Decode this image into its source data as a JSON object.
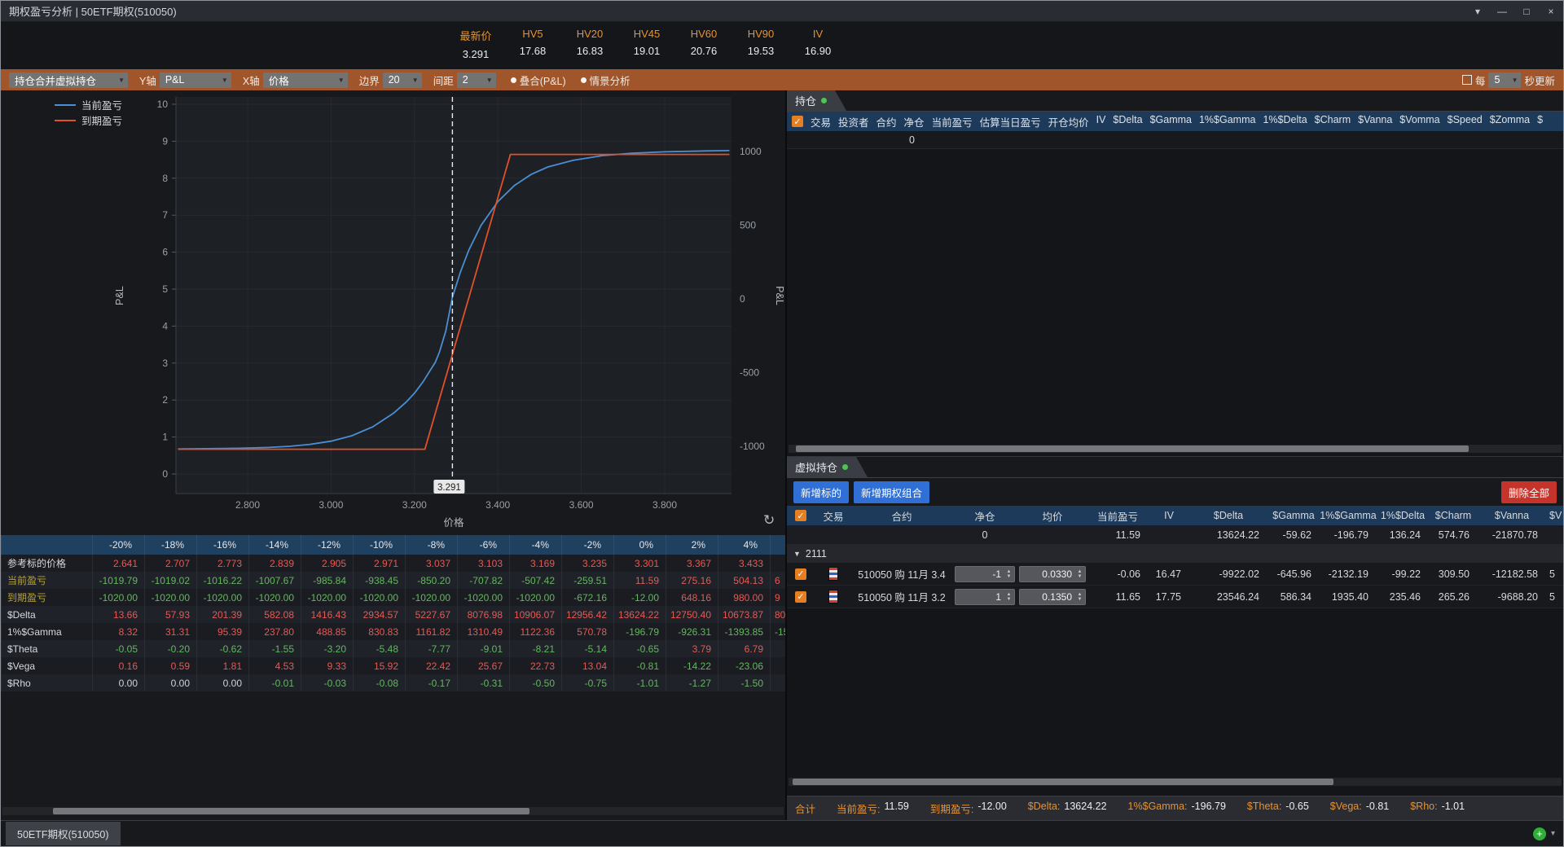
{
  "window": {
    "title": "期权盈亏分析 | 50ETF期权(510050)",
    "controls": {
      "chevron": "▾",
      "minimize": "—",
      "maximize": "□",
      "close": "×"
    }
  },
  "stats": [
    {
      "label": "最新价",
      "value": "3.291"
    },
    {
      "label": "HV5",
      "value": "17.68"
    },
    {
      "label": "HV20",
      "value": "16.83"
    },
    {
      "label": "HV45",
      "value": "19.01"
    },
    {
      "label": "HV60",
      "value": "20.76"
    },
    {
      "label": "HV90",
      "value": "19.53"
    },
    {
      "label": "IV",
      "value": "16.90"
    }
  ],
  "toolbar": {
    "position_mode": "持仓合并虚拟持仓",
    "y_axis_label": "Y轴",
    "y_axis_value": "P&L",
    "x_axis_label": "X轴",
    "x_axis_value": "价格",
    "boundary_label": "边界",
    "boundary_value": "20",
    "interval_label": "间距",
    "interval_value": "2",
    "overlay_label": "叠合(P&L)",
    "scenario_label": "情景分析",
    "refresh_prefix": "每",
    "refresh_value": "5",
    "refresh_suffix": "秒更新"
  },
  "chart": {
    "legend": [
      {
        "name": "当前盈亏",
        "color": "#4a8fd4"
      },
      {
        "name": "到期盈亏",
        "color": "#e0512a"
      }
    ],
    "y_left_ticks": [
      "10",
      "9",
      "8",
      "7",
      "6",
      "5",
      "4",
      "3",
      "2",
      "1",
      "0"
    ],
    "y_right_ticks": [
      "1000",
      "500",
      "0",
      "-500",
      "-1000"
    ],
    "x_ticks": [
      "2.800",
      "3.000",
      "3.200",
      "3.400",
      "3.600",
      "3.800"
    ],
    "x_label": "价格",
    "y_label_left": "P&L",
    "y_label_right": "P&L",
    "marker_value": "3.291",
    "marker_x": 3.291,
    "series": [
      {
        "name": "当前盈亏",
        "color": "#4a8fd4",
        "points": [
          [
            2.633,
            -1018
          ],
          [
            2.7,
            -1016
          ],
          [
            2.78,
            -1013
          ],
          [
            2.85,
            -1008
          ],
          [
            2.9,
            -1000
          ],
          [
            2.95,
            -987
          ],
          [
            3.0,
            -965
          ],
          [
            3.05,
            -928
          ],
          [
            3.1,
            -868
          ],
          [
            3.15,
            -775
          ],
          [
            3.18,
            -700
          ],
          [
            3.2,
            -640
          ],
          [
            3.22,
            -565
          ],
          [
            3.25,
            -430
          ],
          [
            3.26,
            -360
          ],
          [
            3.275,
            -220
          ],
          [
            3.291,
            12
          ],
          [
            3.31,
            180
          ],
          [
            3.33,
            330
          ],
          [
            3.36,
            500
          ],
          [
            3.4,
            660
          ],
          [
            3.44,
            770
          ],
          [
            3.48,
            845
          ],
          [
            3.52,
            895
          ],
          [
            3.58,
            940
          ],
          [
            3.65,
            972
          ],
          [
            3.72,
            988
          ],
          [
            3.8,
            998
          ],
          [
            3.9,
            1004
          ],
          [
            3.955,
            1006
          ]
        ]
      },
      {
        "name": "到期盈亏",
        "color": "#e0512a",
        "points": [
          [
            2.633,
            -1020
          ],
          [
            3.225,
            -1020
          ],
          [
            3.43,
            980
          ],
          [
            3.955,
            980
          ]
        ]
      }
    ]
  },
  "scenario_table": {
    "columns": [
      "-20%",
      "-18%",
      "-16%",
      "-14%",
      "-12%",
      "-10%",
      "-8%",
      "-6%",
      "-4%",
      "-2%",
      "0%",
      "2%",
      "4%"
    ],
    "partial_header": "",
    "rows": [
      {
        "label": "参考标的价格",
        "accent": false,
        "partial": "",
        "values": [
          "2.641",
          "2.707",
          "2.773",
          "2.839",
          "2.905",
          "2.971",
          "3.037",
          "3.103",
          "3.169",
          "3.235",
          "3.301",
          "3.367",
          "3.433"
        ]
      },
      {
        "label": "当前盈亏",
        "accent": true,
        "partial": "6",
        "values": [
          "-1019.79",
          "-1019.02",
          "-1016.22",
          "-1007.67",
          "-985.84",
          "-938.45",
          "-850.20",
          "-707.82",
          "-507.42",
          "-259.51",
          "11.59",
          "275.16",
          "504.13"
        ]
      },
      {
        "label": "到期盈亏",
        "accent": true,
        "partial": "9",
        "values": [
          "-1020.00",
          "-1020.00",
          "-1020.00",
          "-1020.00",
          "-1020.00",
          "-1020.00",
          "-1020.00",
          "-1020.00",
          "-1020.00",
          "-672.16",
          "-12.00",
          "648.16",
          "980.00"
        ]
      },
      {
        "label": "$Delta",
        "accent": false,
        "partial": "80",
        "values": [
          "13.66",
          "57.93",
          "201.39",
          "582.08",
          "1416.43",
          "2934.57",
          "5227.67",
          "8076.98",
          "10906.07",
          "12956.42",
          "13624.22",
          "12750.40",
          "10673.87"
        ]
      },
      {
        "label": "1%$Gamma",
        "accent": false,
        "partial": "-15",
        "values": [
          "8.32",
          "31.31",
          "95.39",
          "237.80",
          "488.85",
          "830.83",
          "1161.82",
          "1310.49",
          "1122.36",
          "570.78",
          "-196.79",
          "-926.31",
          "-1393.85"
        ]
      },
      {
        "label": "$Theta",
        "accent": false,
        "partial": "",
        "values": [
          "-0.05",
          "-0.20",
          "-0.62",
          "-1.55",
          "-3.20",
          "-5.48",
          "-7.77",
          "-9.01",
          "-8.21",
          "-5.14",
          "-0.65",
          "3.79",
          "6.79"
        ]
      },
      {
        "label": "$Vega",
        "accent": false,
        "partial": "",
        "values": [
          "0.16",
          "0.59",
          "1.81",
          "4.53",
          "9.33",
          "15.92",
          "22.42",
          "25.67",
          "22.73",
          "13.04",
          "-0.81",
          "-14.22",
          "-23.06"
        ]
      },
      {
        "label": "$Rho",
        "accent": false,
        "partial": "",
        "values": [
          "0.00",
          "0.00",
          "0.00",
          "-0.01",
          "-0.03",
          "-0.08",
          "-0.17",
          "-0.31",
          "-0.50",
          "-0.75",
          "-1.01",
          "-1.27",
          "-1.50"
        ]
      }
    ]
  },
  "positions": {
    "tab": "持仓",
    "columns": [
      "交易",
      "投资者",
      "合约",
      "净仓",
      "当前盈亏",
      "估算当日盈亏",
      "开仓均价",
      "IV",
      "$Delta",
      "$Gamma",
      "1%$Gamma",
      "1%$Delta",
      "$Charm",
      "$Vanna",
      "$Vomma",
      "$Speed",
      "$Zomma",
      "$"
    ],
    "zero_value": "0"
  },
  "virtual": {
    "tab": "虚拟持仓",
    "buttons": [
      "新增标的",
      "新增期权组合"
    ],
    "delete_button": "删除全部",
    "columns": [
      "交易",
      "合约",
      "净仓",
      "均价",
      "当前盈亏",
      "IV",
      "$Delta",
      "$Gamma",
      "1%$Gamma",
      "1%$Delta",
      "$Charm",
      "$Vanna"
    ],
    "partial_column": "$V",
    "summary": [
      "",
      "",
      "0",
      "",
      "11.59",
      "",
      "13624.22",
      "-59.62",
      "-196.79",
      "136.24",
      "574.76",
      "-21870.78"
    ],
    "group": "2111",
    "rows": [
      {
        "contract": "510050 购 11月 3.4",
        "net": "-1",
        "price": "0.0330",
        "partial": "5",
        "values": [
          "-0.06",
          "16.47",
          "-9922.02",
          "-645.96",
          "-2132.19",
          "-99.22",
          "309.50",
          "-12182.58"
        ]
      },
      {
        "contract": "510050 购 11月 3.2",
        "net": "1",
        "price": "0.1350",
        "partial": "5",
        "values": [
          "11.65",
          "17.75",
          "23546.24",
          "586.34",
          "1935.40",
          "235.46",
          "265.26",
          "-9688.20"
        ]
      }
    ]
  },
  "totals": {
    "prefix": "合计",
    "items": [
      {
        "label": "当前盈亏",
        "value": "11.59"
      },
      {
        "label": "到期盈亏",
        "value": "-12.00"
      },
      {
        "label": "$Delta",
        "value": "13624.22"
      },
      {
        "label": "1%$Gamma",
        "value": "-196.79"
      },
      {
        "label": "$Theta",
        "value": "-0.65"
      },
      {
        "label": "$Vega",
        "value": "-0.81"
      },
      {
        "label": "$Rho",
        "value": "-1.01"
      }
    ]
  },
  "statusbar": {
    "tab": "50ETF期权(510050)",
    "add_icon": "+",
    "caret_icon": "▾"
  },
  "icons": {
    "refresh": "↻",
    "dropdown": "▼",
    "check": "✓",
    "group_triangle": "▼"
  }
}
